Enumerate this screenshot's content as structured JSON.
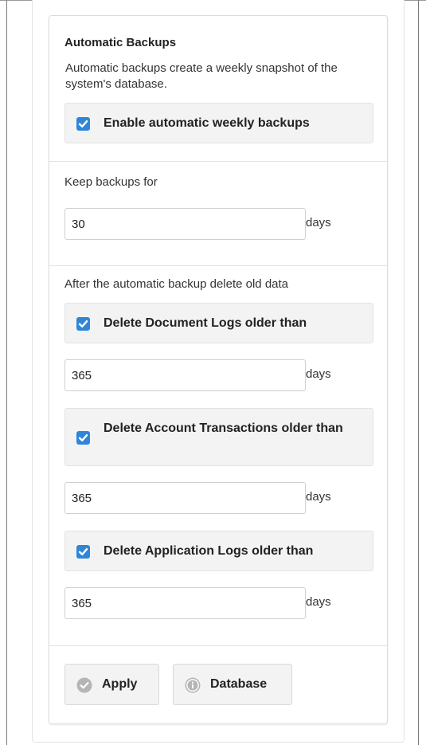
{
  "backups": {
    "heading": "Automatic Backups",
    "description": "Automatic backups create a weekly snapshot of the system's database.",
    "enable_label": "Enable automatic weekly backups",
    "enable_checked": true
  },
  "keep": {
    "label": "Keep backups for",
    "value": "30",
    "unit": "days"
  },
  "cleanup": {
    "label": "After the automatic backup delete old data",
    "document_logs": {
      "label": "Delete Document Logs older than",
      "checked": true,
      "value": "365",
      "unit": "days"
    },
    "account_transactions": {
      "label": "Delete Account Transactions older than",
      "checked": true,
      "value": "365",
      "unit": "days"
    },
    "application_logs": {
      "label": "Delete Application Logs older than",
      "checked": true,
      "value": "365",
      "unit": "days"
    }
  },
  "actions": {
    "apply_label": "Apply",
    "database_label": "Database"
  },
  "colors": {
    "checkbox": "#2f86d8",
    "well": "#f3f3f3"
  },
  "icons": {
    "checkbox": "checkmark-icon",
    "apply": "check-circle-icon",
    "database": "info-circle-icon"
  }
}
